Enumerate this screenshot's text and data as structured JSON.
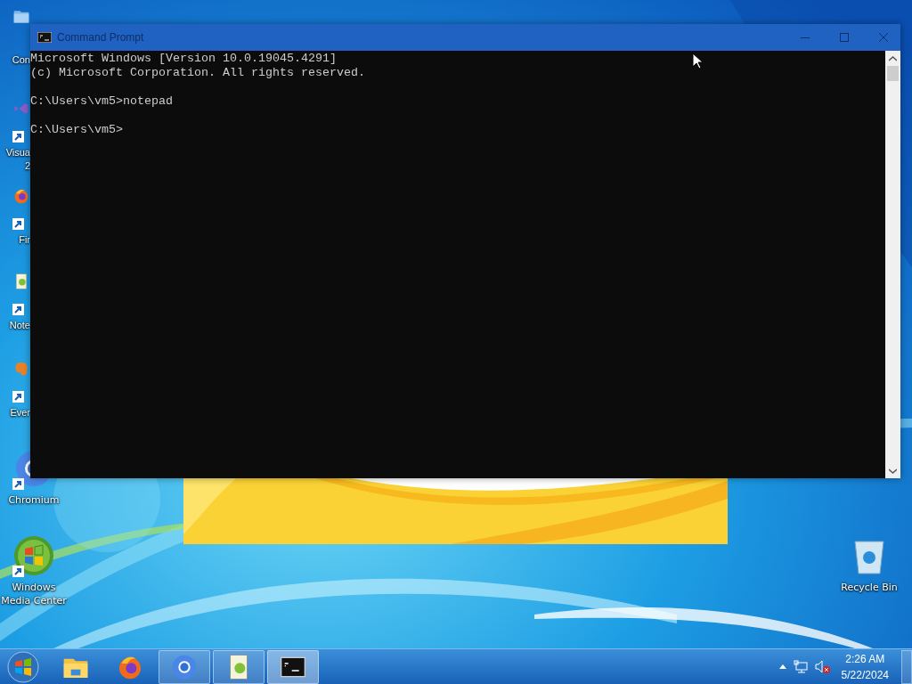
{
  "desktop_icons": [
    {
      "kind": "folder",
      "shortcut": false,
      "lines": [
        "Con"
      ]
    },
    {
      "kind": "studio",
      "shortcut": true,
      "lines": [
        "Visua",
        "2"
      ]
    },
    {
      "kind": "firefox",
      "shortcut": true,
      "lines": [
        "Fir"
      ]
    },
    {
      "kind": "notepad",
      "shortcut": true,
      "lines": [
        "Note"
      ]
    },
    {
      "kind": "evernote",
      "shortcut": true,
      "lines": [
        "Ever"
      ]
    },
    {
      "kind": "chromium",
      "shortcut": true,
      "lines": [
        "Chromium"
      ]
    },
    {
      "kind": "mediacenter",
      "shortcut": true,
      "lines": [
        "Windows",
        "Media Center"
      ]
    },
    {
      "kind": "recycle",
      "shortcut": false,
      "lines": [
        "Recycle Bin"
      ]
    }
  ],
  "console_window": {
    "title": "Command Prompt",
    "blocks": [
      [
        "Microsoft Windows [Version 10.0.19045.4291]",
        "(c) Microsoft Corporation. All rights reserved."
      ],
      [
        "C:\\Users\\vm5>notepad"
      ],
      [
        "C:\\Users\\vm5>"
      ]
    ]
  },
  "taskbar": {
    "buttons": [
      {
        "kind": "explorer",
        "running": false,
        "selected": false
      },
      {
        "kind": "firefox",
        "running": false,
        "selected": false
      },
      {
        "kind": "chromium",
        "running": true,
        "selected": false
      },
      {
        "kind": "notepad",
        "running": true,
        "selected": false
      },
      {
        "kind": "console",
        "running": true,
        "selected": true
      }
    ],
    "clock": {
      "time": "2:26 AM",
      "date": "5/22/2024"
    }
  }
}
